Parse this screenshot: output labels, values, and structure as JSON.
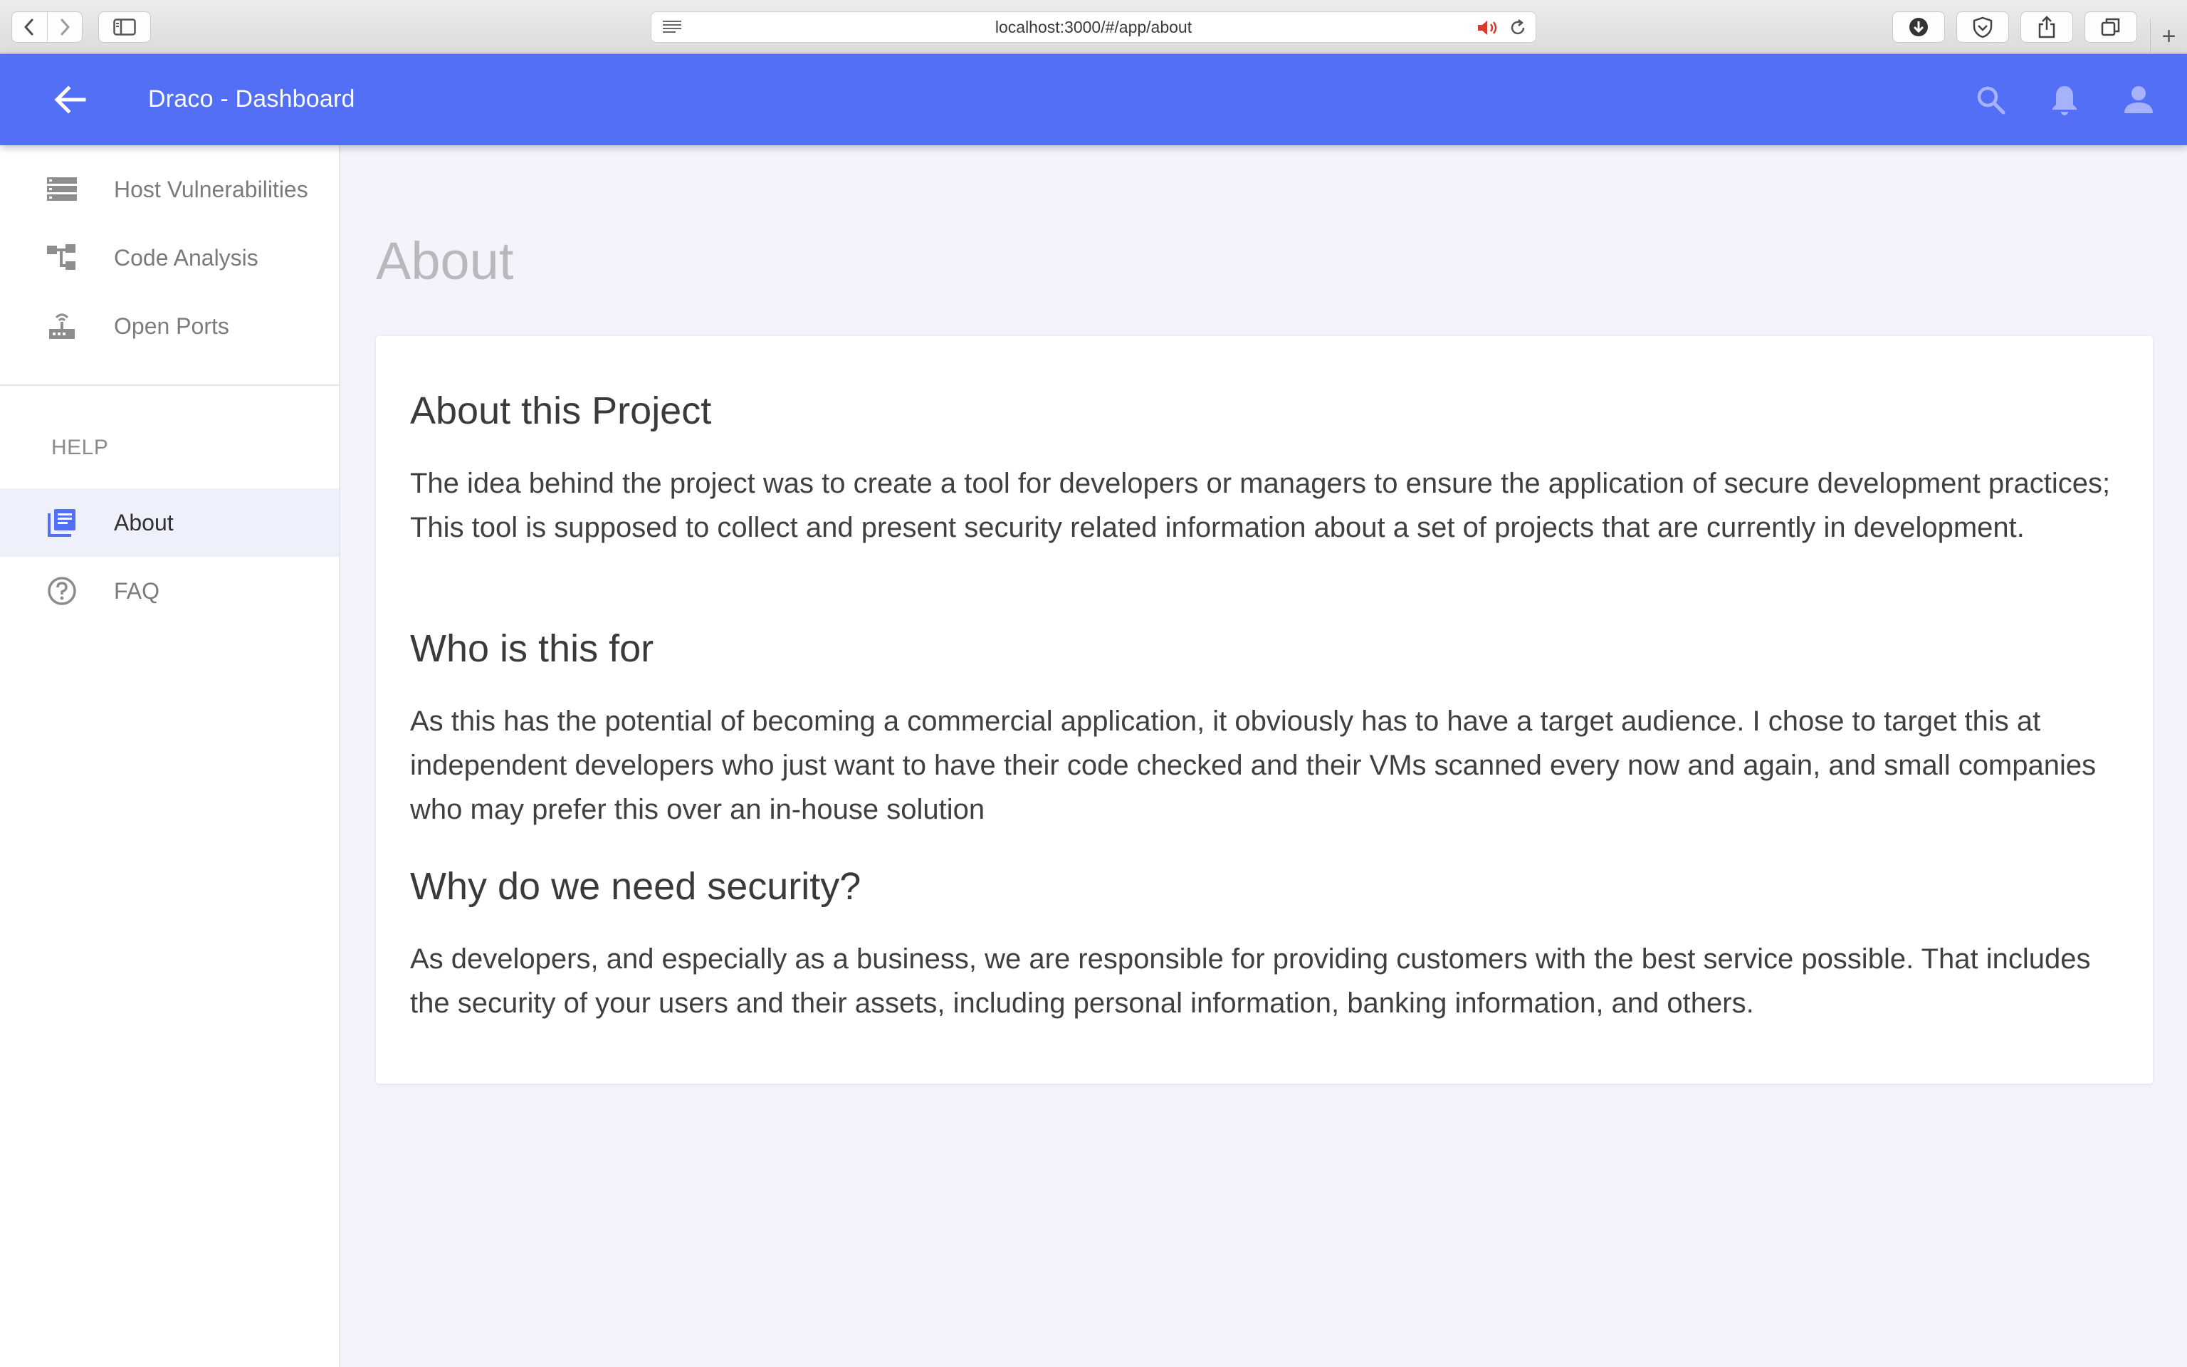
{
  "browser": {
    "url": "localhost:3000/#/app/about",
    "new_tab": "+"
  },
  "app_bar": {
    "title": "Draco - Dashboard",
    "color": "#536ff5",
    "icons": [
      "arrow-back-icon",
      "search-icon",
      "bell-icon",
      "account-icon"
    ]
  },
  "sidebar": {
    "items": [
      {
        "label": "Host Vulnerabilities",
        "icon": "server-list-icon"
      },
      {
        "label": "Code Analysis",
        "icon": "tree-structure-icon"
      },
      {
        "label": "Open Ports",
        "icon": "router-icon"
      }
    ],
    "help_section": "HELP",
    "help_items": [
      {
        "label": "About",
        "icon": "library-books-icon",
        "active": true
      },
      {
        "label": "FAQ",
        "icon": "help-circle-icon",
        "active": false
      }
    ]
  },
  "main": {
    "page_title": "About",
    "sections": [
      {
        "heading": "About this Project",
        "body": "The idea behind the project was to create a tool for developers or managers to ensure the application of secure development practices; This tool is supposed to collect and present security related information about a set of projects that are currently in development."
      },
      {
        "heading": "Who is this for",
        "body": "As this has the potential of becoming a commercial application, it obviously has to have a target audience. I chose to target this at independent developers who just want to have their code checked and their VMs scanned every now and again, and small companies who may prefer this over an in-house solution"
      },
      {
        "heading": "Why do we need security?",
        "body": "As developers, and especially as a business, we are responsible for providing customers with the best service possible. That includes the security of your users and their assets, including personal information, banking information, and others."
      }
    ]
  }
}
